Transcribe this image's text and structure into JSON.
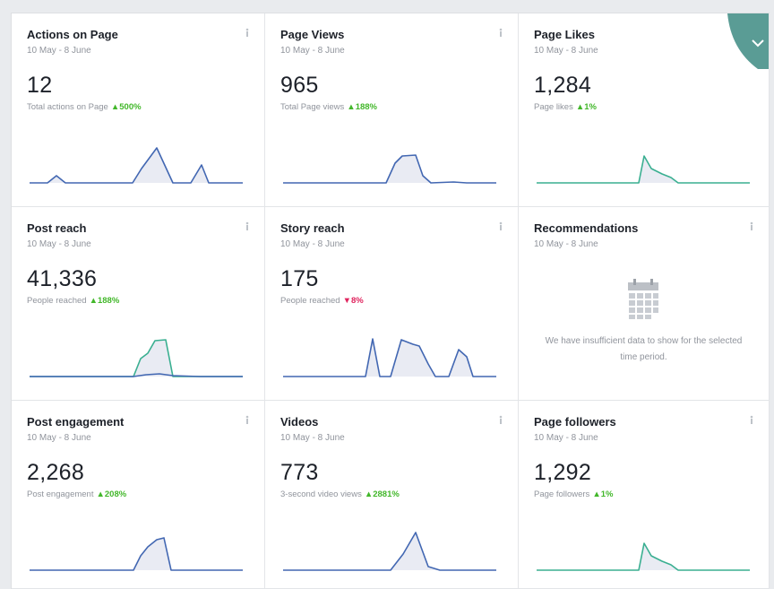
{
  "cards": [
    {
      "title": "Actions on Page",
      "range": "10 May - 8 June",
      "value": "12",
      "sub": "Total actions on Page",
      "delta": "500%",
      "direction": "up",
      "series": [
        {
          "color": "#4267b2",
          "points": [
            [
              0,
              44
            ],
            [
              10,
              44
            ],
            [
              20,
              44
            ],
            [
              30,
              36
            ],
            [
              40,
              44
            ],
            [
              60,
              44
            ],
            [
              80,
              44
            ],
            [
              100,
              44
            ],
            [
              115,
              44
            ],
            [
              125,
              28
            ],
            [
              142,
              5
            ],
            [
              160,
              44
            ],
            [
              180,
              44
            ],
            [
              192,
              24
            ],
            [
              200,
              44
            ],
            [
              220,
              44
            ],
            [
              238,
              44
            ]
          ]
        }
      ]
    },
    {
      "title": "Page Views",
      "range": "10 May - 8 June",
      "value": "965",
      "sub": "Total Page views",
      "delta": "188%",
      "direction": "up",
      "series": [
        {
          "color": "#4267b2",
          "points": [
            [
              0,
              44
            ],
            [
              30,
              44
            ],
            [
              60,
              44
            ],
            [
              90,
              44
            ],
            [
              115,
              44
            ],
            [
              125,
              22
            ],
            [
              133,
              14
            ],
            [
              148,
              13
            ],
            [
              156,
              36
            ],
            [
              165,
              44
            ],
            [
              190,
              43
            ],
            [
              205,
              44
            ],
            [
              238,
              44
            ]
          ]
        }
      ]
    },
    {
      "title": "Page Likes",
      "range": "10 May - 8 June",
      "value": "1,284",
      "sub": "Page likes",
      "delta": "1%",
      "direction": "up",
      "series": [
        {
          "color": "#3aaf91",
          "points": [
            [
              0,
              44
            ],
            [
              40,
              44
            ],
            [
              80,
              44
            ],
            [
              114,
              44
            ],
            [
              120,
              14
            ],
            [
              128,
              28
            ],
            [
              140,
              34
            ],
            [
              150,
              38
            ],
            [
              158,
              44
            ],
            [
              190,
              44
            ],
            [
              238,
              44
            ]
          ]
        }
      ]
    },
    {
      "title": "Post reach",
      "range": "10 May - 8 June",
      "value": "41,336",
      "sub": "People reached",
      "delta": "188%",
      "direction": "up",
      "series": [
        {
          "color": "#3aaf91",
          "points": [
            [
              0,
              44
            ],
            [
              60,
              44
            ],
            [
              100,
              44
            ],
            [
              116,
              44
            ],
            [
              124,
              24
            ],
            [
              132,
              18
            ],
            [
              140,
              4
            ],
            [
              152,
              3
            ],
            [
              160,
              44
            ],
            [
              190,
              44
            ],
            [
              238,
              44
            ]
          ]
        },
        {
          "color": "#4267b2",
          "points": [
            [
              0,
              44
            ],
            [
              60,
              44
            ],
            [
              100,
              44
            ],
            [
              116,
              44
            ],
            [
              130,
              42
            ],
            [
              145,
              41
            ],
            [
              160,
              43
            ],
            [
              190,
              44
            ],
            [
              238,
              44
            ]
          ]
        }
      ]
    },
    {
      "title": "Story reach",
      "range": "10 May - 8 June",
      "value": "175",
      "sub": "People reached",
      "delta": "8%",
      "direction": "down",
      "series": [
        {
          "color": "#4267b2",
          "points": [
            [
              0,
              44
            ],
            [
              40,
              44
            ],
            [
              80,
              44
            ],
            [
              92,
              44
            ],
            [
              100,
              2
            ],
            [
              108,
              44
            ],
            [
              120,
              44
            ],
            [
              132,
              3
            ],
            [
              145,
              8
            ],
            [
              152,
              10
            ],
            [
              162,
              30
            ],
            [
              170,
              44
            ],
            [
              185,
              44
            ],
            [
              196,
              14
            ],
            [
              205,
              22
            ],
            [
              212,
              44
            ],
            [
              238,
              44
            ]
          ]
        }
      ]
    },
    {
      "title": "Recommendations",
      "range": "10 May - 8 June",
      "message": "We have insufficient data to show for the selected time period."
    },
    {
      "title": "Post engagement",
      "range": "10 May - 8 June",
      "value": "2,268",
      "sub": "Post engagement",
      "delta": "208%",
      "direction": "up",
      "series": [
        {
          "color": "#4267b2",
          "points": [
            [
              0,
              44
            ],
            [
              40,
              44
            ],
            [
              80,
              44
            ],
            [
              116,
              44
            ],
            [
              124,
              28
            ],
            [
              132,
              18
            ],
            [
              142,
              10
            ],
            [
              150,
              8
            ],
            [
              158,
              44
            ],
            [
              190,
              44
            ],
            [
              238,
              44
            ]
          ]
        }
      ]
    },
    {
      "title": "Videos",
      "range": "10 May - 8 June",
      "value": "773",
      "sub": "3-second video views",
      "delta": "2881%",
      "direction": "up",
      "series": [
        {
          "color": "#4267b2",
          "points": [
            [
              0,
              44
            ],
            [
              40,
              44
            ],
            [
              80,
              44
            ],
            [
              120,
              44
            ],
            [
              134,
              26
            ],
            [
              148,
              2
            ],
            [
              162,
              40
            ],
            [
              175,
              44
            ],
            [
              205,
              44
            ],
            [
              238,
              44
            ]
          ]
        }
      ]
    },
    {
      "title": "Page followers",
      "range": "10 May - 8 June",
      "value": "1,292",
      "sub": "Page followers",
      "delta": "1%",
      "direction": "up",
      "series": [
        {
          "color": "#3aaf91",
          "points": [
            [
              0,
              44
            ],
            [
              40,
              44
            ],
            [
              80,
              44
            ],
            [
              114,
              44
            ],
            [
              120,
              14
            ],
            [
              128,
              28
            ],
            [
              140,
              34
            ],
            [
              150,
              38
            ],
            [
              158,
              44
            ],
            [
              190,
              44
            ],
            [
              238,
              44
            ]
          ]
        }
      ]
    }
  ],
  "colors": {
    "up": "#42b72a",
    "down": "#e0245e",
    "fill": "#dfe3ee",
    "badge": "#3d8b82"
  }
}
